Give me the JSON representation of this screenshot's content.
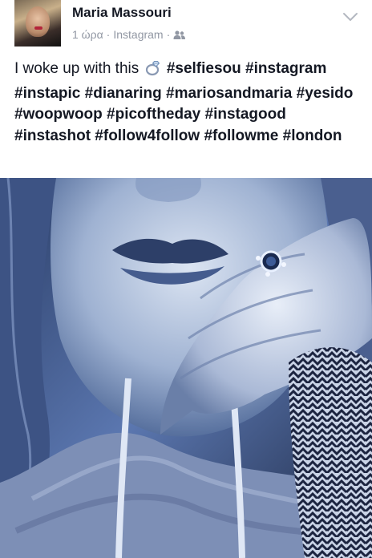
{
  "post": {
    "author_name": "Maria Massouri",
    "time": "1 ώρα",
    "source": "Instagram",
    "separator": "·",
    "text_before": "I woke up with this",
    "emoji_icon": "ring-icon",
    "hashtags_line1": "#selfiesou #instagram",
    "hashtags_rest": "#instapic #dianaring #mariosandmaria #yesido #woopwoop #picoftheday #instagood #instashot #follow4follow #followme #london"
  },
  "icons": {
    "audience": "friends-icon",
    "menu": "chevron-down-icon"
  },
  "colors": {
    "name": "#141823",
    "meta": "#9197a3",
    "photo_tint": "#4a6cb0"
  }
}
